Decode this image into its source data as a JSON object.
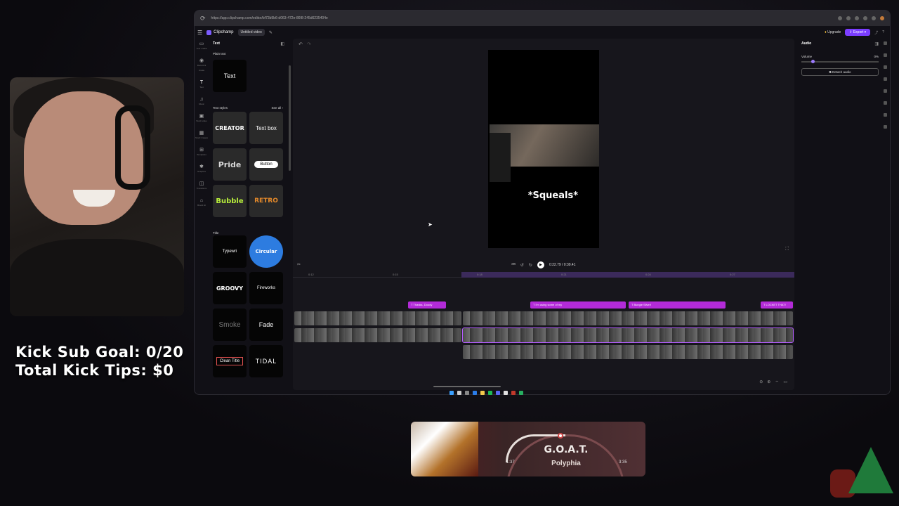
{
  "overlay": {
    "sub_goal": "Kick Sub Goal: 0/20",
    "tips": "Total Kick Tips: $0"
  },
  "browser": {
    "url": "https://app.clipchamp.com/editor/bf73b9b6-d063-472e-86f8-245d6235404e"
  },
  "app": {
    "name": "Clipchamp",
    "project": "Untitled video",
    "upgrade": "Upgrade",
    "export": "Export"
  },
  "left_rail": [
    {
      "icon": "media-icon",
      "label": "Your media"
    },
    {
      "icon": "record-icon",
      "label": "Record & create"
    },
    {
      "icon": "text-icon",
      "label": "Text"
    },
    {
      "icon": "music-icon",
      "label": "Music"
    },
    {
      "icon": "video-icon",
      "label": "Stock video"
    },
    {
      "icon": "image-icon",
      "label": "Stock images"
    },
    {
      "icon": "templates-icon",
      "label": "Templates"
    },
    {
      "icon": "graphics-icon",
      "label": "Graphics"
    },
    {
      "icon": "transitions-icon",
      "label": "Transitions"
    },
    {
      "icon": "brand-icon",
      "label": "Brand kit"
    }
  ],
  "text_panel": {
    "title": "Text",
    "plain_section": "Plain text",
    "plain_tile": "Text",
    "styles_section": "Text styles",
    "see_all": "See all",
    "styles": [
      "CREATOR",
      "Text box",
      "Pride",
      "Button",
      "Bubble",
      "RETRO"
    ],
    "title_section": "Title",
    "titles": [
      "Typewri",
      "Circular",
      "GROOVY",
      "Fireworks",
      "Smoke",
      "Fade",
      "Clean Title",
      "TIDAL"
    ]
  },
  "preview": {
    "caption": "*Squeals*"
  },
  "playback": {
    "time": "0:22.79 / 0:39.41"
  },
  "timeline": {
    "captions": [
      "Thanks, Doody",
      "I'm using some of my",
      "Bungie Silver!",
      "LOCKET THAT!"
    ],
    "ticks": [
      "0:12",
      "0:15",
      "0:18",
      "0:21",
      "0:24",
      "0:27",
      "0:30",
      "0:33",
      "0:36"
    ]
  },
  "properties": {
    "tab": "Audio",
    "volume_label": "Volume",
    "volume_value": "0%",
    "detach": "Detach audio"
  },
  "now_playing": {
    "song": "G.O.A.T.",
    "artist": "Polyphia",
    "elapsed": "1:37",
    "total": "3:35",
    "progress": 0.45
  },
  "colors": {
    "accent": "#7b3dff",
    "caption_clip": "#b32bd8"
  }
}
